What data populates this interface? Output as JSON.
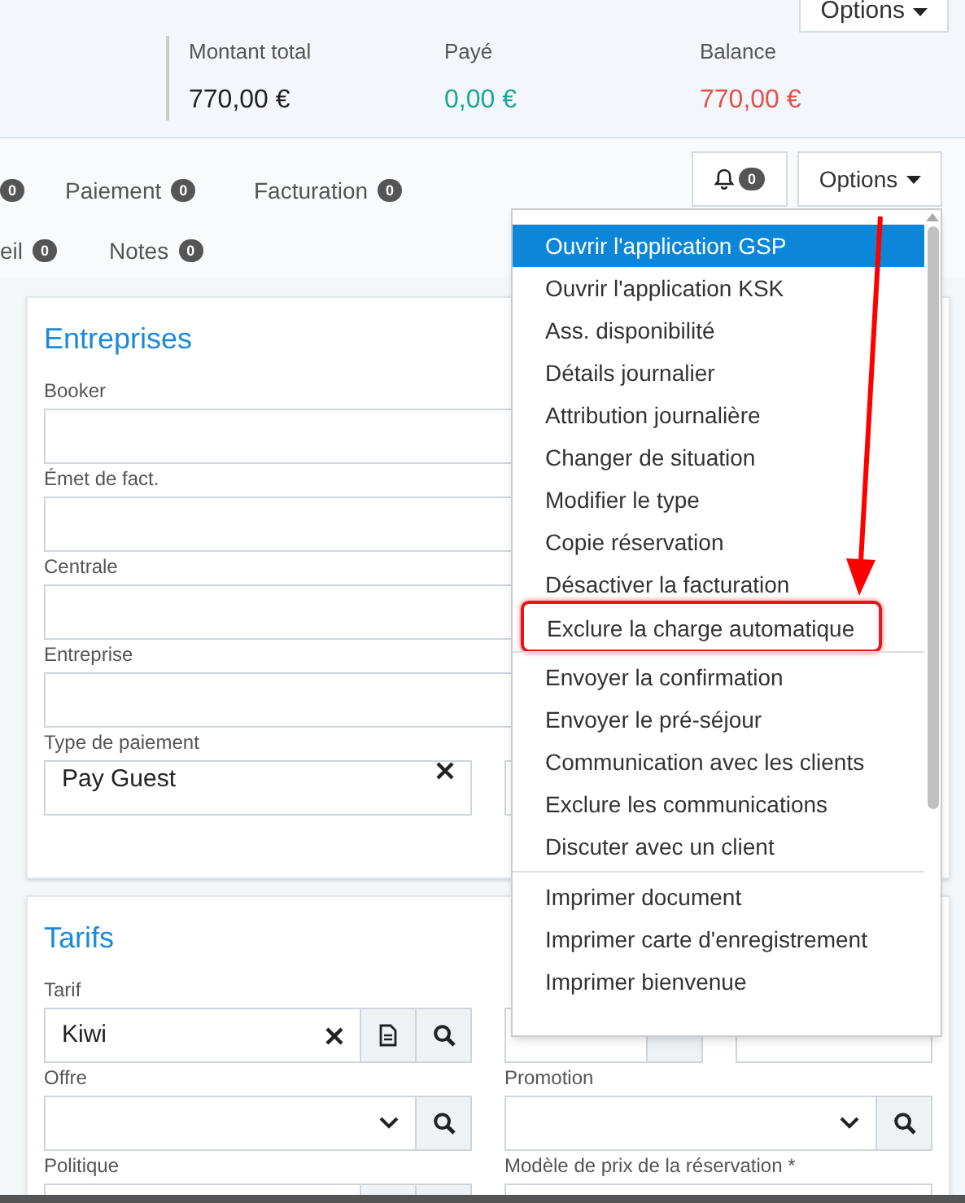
{
  "header": {
    "options_button": "Options",
    "summary": [
      {
        "label": "Montant total",
        "value": "770,00 €",
        "color": "#222222"
      },
      {
        "label": "Payé",
        "value": "0,00 €",
        "color": "#17a89a"
      },
      {
        "label": "Balance",
        "value": "770,00 €",
        "color": "#e6504a"
      }
    ]
  },
  "tabs": [
    [
      {
        "count": "0"
      },
      {
        "label": "Paiement",
        "count": "0"
      },
      {
        "label": "Facturation",
        "count": "0"
      }
    ],
    [
      {
        "label": "eil",
        "count": "0"
      },
      {
        "label": "Notes",
        "count": "0"
      }
    ]
  ],
  "toolbar": {
    "notifications_count": "0",
    "options_button": "Options"
  },
  "menu": {
    "groups": [
      [
        {
          "label": "Ouvrir l'application GSP",
          "selected": true,
          "annotated": false
        },
        {
          "label": "Ouvrir l'application KSK",
          "selected": false,
          "annotated": false
        },
        {
          "label": "Ass. disponibilité",
          "selected": false,
          "annotated": false
        },
        {
          "label": "Détails journalier",
          "selected": false,
          "annotated": false
        },
        {
          "label": "Attribution journalière",
          "selected": false,
          "annotated": false
        },
        {
          "label": "Changer de situation",
          "selected": false,
          "annotated": false
        },
        {
          "label": "Modifier le type",
          "selected": false,
          "annotated": false
        },
        {
          "label": "Copie réservation",
          "selected": false,
          "annotated": false
        },
        {
          "label": "Désactiver la facturation",
          "selected": false,
          "annotated": false
        },
        {
          "label": "Exclure la charge automatique",
          "selected": false,
          "annotated": true
        }
      ],
      [
        {
          "label": "Envoyer la confirmation",
          "selected": false,
          "annotated": false
        },
        {
          "label": "Envoyer le pré-séjour",
          "selected": false,
          "annotated": false
        },
        {
          "label": "Communication avec les clients",
          "selected": false,
          "annotated": false
        },
        {
          "label": "Exclure les communications",
          "selected": false,
          "annotated": false
        },
        {
          "label": "Discuter avec un client",
          "selected": false,
          "annotated": false
        }
      ],
      [
        {
          "label": "Imprimer document",
          "selected": false,
          "annotated": false
        },
        {
          "label": "Imprimer carte d'enregistrement",
          "selected": false,
          "annotated": false
        },
        {
          "label": "Imprimer bienvenue",
          "selected": false,
          "annotated": false
        }
      ]
    ]
  },
  "sections": [
    {
      "title": "Entreprises",
      "rows": [
        [
          {
            "label": "Booker",
            "kind": "text"
          }
        ],
        [
          {
            "label": "Émet de fact.",
            "kind": "text"
          }
        ],
        [
          {
            "label": "Centrale",
            "kind": "text"
          }
        ],
        [
          {
            "label": "Entreprise",
            "kind": "text"
          }
        ],
        [
          {
            "label": "Type de paiement",
            "kind": "clearable",
            "value": "Pay Guest"
          },
          {
            "kind": "text"
          }
        ]
      ]
    },
    {
      "title": "Tarifs",
      "rows": [
        [
          {
            "label": "Tarif",
            "kind": "lookup",
            "value": "Kiwi"
          },
          {
            "kind": "pair"
          }
        ],
        [
          {
            "label": "Offre",
            "kind": "select"
          },
          {
            "label": "Promotion",
            "kind": "select"
          }
        ],
        [
          {
            "label": "Politique",
            "kind": "addons"
          },
          {
            "label": "Modèle de prix de la réservation *",
            "kind": "text"
          }
        ]
      ]
    }
  ]
}
